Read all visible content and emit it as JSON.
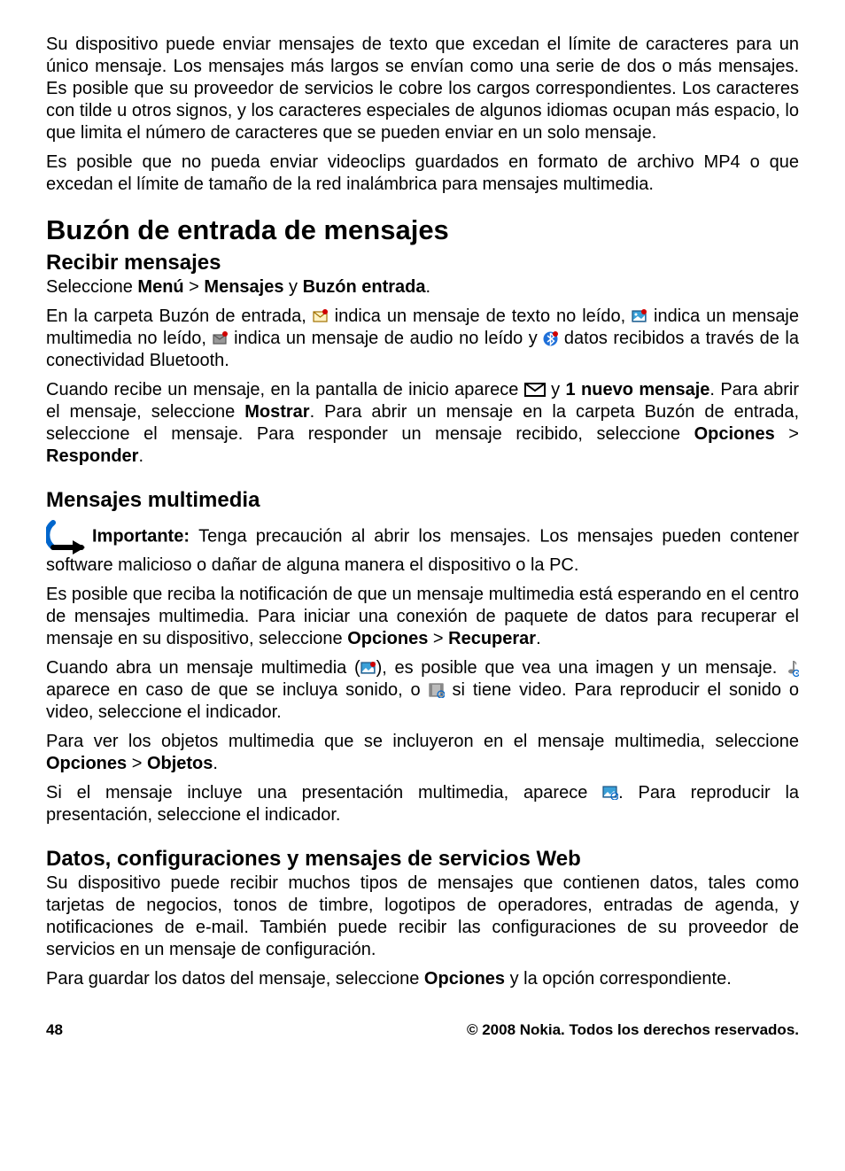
{
  "intro": {
    "p1": "Su dispositivo puede enviar mensajes de texto que excedan el límite de caracteres para un único mensaje. Los mensajes más largos se envían como una serie de dos o más mensajes. Es posible que su proveedor de servicios le cobre los cargos correspondientes. Los caracteres con tilde u otros signos, y los caracteres especiales de algunos idiomas ocupan más espacio, lo que limita el número de caracteres que se pueden enviar en un solo mensaje.",
    "p2": "Es posible que no pueda enviar videoclips guardados en formato de archivo MP4 o que excedan el límite de tamaño de la red inalámbrica para mensajes multimedia."
  },
  "h1": "Buzón de entrada de mensajes",
  "recibir": {
    "h2": "Recibir mensajes",
    "sel_pre": "Seleccione ",
    "sel_menu": "Menú",
    "sel_gt1": " > ",
    "sel_mensajes": "Mensajes",
    "sel_y": " y ",
    "sel_buzon": "Buzón entrada",
    "sel_post": ".",
    "carpeta_a": "En la carpeta Buzón de entrada, ",
    "carpeta_b": " indica un mensaje de texto no leído, ",
    "carpeta_c": " indica un mensaje multimedia no leído, ",
    "carpeta_d": " indica un mensaje de audio no leído y ",
    "carpeta_e": " datos recibidos a través de la conectividad Bluetooth.",
    "cuando_a": "Cuando recibe un mensaje, en la pantalla de inicio aparece ",
    "cuando_b": " y ",
    "cuando_bold1": "1 nuevo mensaje",
    "cuando_c": ". Para abrir el mensaje, seleccione ",
    "cuando_bold2": "Mostrar",
    "cuando_d": ". Para abrir un mensaje en la carpeta Buzón de entrada, seleccione el mensaje. Para responder un mensaje recibido, seleccione ",
    "cuando_bold3": "Opciones",
    "cuando_gt": " > ",
    "cuando_bold4": "Responder",
    "cuando_e": "."
  },
  "mm": {
    "h2": "Mensajes multimedia",
    "importante_label": "Importante: ",
    "importante_text": " Tenga precaución al abrir los mensajes. Los mensajes pueden contener software malicioso o dañar de alguna manera el dispositivo o la PC.",
    "p2a": "Es posible que reciba la notificación de que un mensaje multimedia está esperando en el centro de mensajes multimedia. Para iniciar una conexión de paquete de datos para recuperar el mensaje en su dispositivo, seleccione ",
    "p2_opciones": "Opciones",
    "p2_gt": " > ",
    "p2_recuperar": "Recuperar",
    "p2b": ".",
    "p3a": "Cuando abra un mensaje multimedia (",
    "p3b": "), es posible que vea una imagen y un mensaje. ",
    "p3c": " aparece en caso de que se incluya sonido, o ",
    "p3d": " si tiene video. Para reproducir el sonido o video, seleccione el indicador.",
    "p4a": "Para ver los objetos multimedia que se incluyeron en el mensaje multimedia, seleccione ",
    "p4_opciones": "Opciones",
    "p4_gt": " > ",
    "p4_objetos": "Objetos",
    "p4b": ".",
    "p5a": "Si el mensaje incluye una presentación multimedia, aparece ",
    "p5b": ". Para reproducir la presentación, seleccione el indicador."
  },
  "datos": {
    "h2": "Datos, configuraciones y mensajes de servicios Web",
    "p1": "Su dispositivo puede recibir muchos tipos de mensajes que contienen datos, tales como tarjetas de negocios, tonos de timbre, logotipos de operadores, entradas de agenda, y notificaciones de e-mail. También puede recibir las configuraciones de su proveedor de servicios en un mensaje de configuración.",
    "p2a": "Para guardar los datos del mensaje, seleccione ",
    "p2_opciones": "Opciones",
    "p2b": " y la opción correspondiente."
  },
  "footer": {
    "page": "48",
    "copyright": "© 2008 Nokia. Todos los derechos reservados."
  }
}
